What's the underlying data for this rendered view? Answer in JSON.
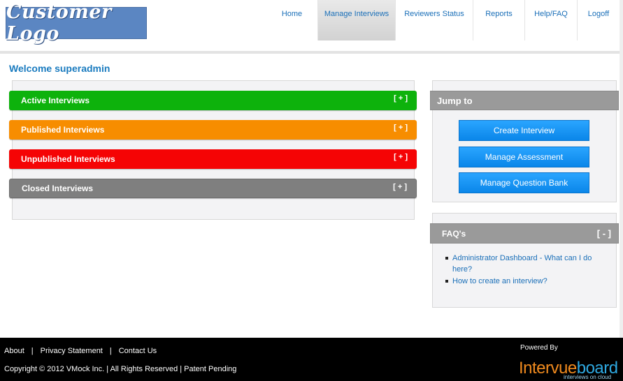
{
  "header": {
    "logo_text": "Customer Logo",
    "nav": [
      {
        "label": "Home",
        "active": false
      },
      {
        "label": "Manage Interviews",
        "active": true
      },
      {
        "label": "Reviewers Status",
        "active": false
      },
      {
        "label": "Reports",
        "active": false
      },
      {
        "label": "Help/FAQ",
        "active": false
      },
      {
        "label": "Logoff",
        "active": false
      }
    ]
  },
  "welcome": "Welcome superadmin",
  "interview_sections": [
    {
      "label": "Active Interviews",
      "toggle": "[ + ]",
      "color": "#0db20c"
    },
    {
      "label": "Published Interviews",
      "toggle": "[ + ]",
      "color": "#f78d00"
    },
    {
      "label": "Unpublished Interviews",
      "toggle": "[ + ]",
      "color": "#f50405"
    },
    {
      "label": "Closed Interviews",
      "toggle": "[ + ]",
      "color": "#7f7f7f"
    }
  ],
  "jump_to": {
    "title": "Jump to",
    "buttons": [
      "Create Interview",
      "Manage Assessment",
      "Manage Question Bank"
    ]
  },
  "faq": {
    "title": "FAQ's",
    "toggle": "[ - ]",
    "items": [
      "Administrator Dashboard - What can I do here?",
      "How to create an interview?"
    ]
  },
  "footer": {
    "links": [
      "About",
      "Privacy Statement",
      "Contact Us"
    ],
    "separator": "|",
    "copyright": "Copyright © 2012 VMock Inc. | All Rights Reserved | Patent Pending",
    "powered_by": "Powered By",
    "brand_part1": "Intervue",
    "brand_part2": "board",
    "tagline": "interviews on cloud"
  },
  "colors": {
    "link_blue": "#1a6fb8",
    "button_blue": "#1a96f5",
    "panel_header_gray": "#9a9a9a"
  }
}
